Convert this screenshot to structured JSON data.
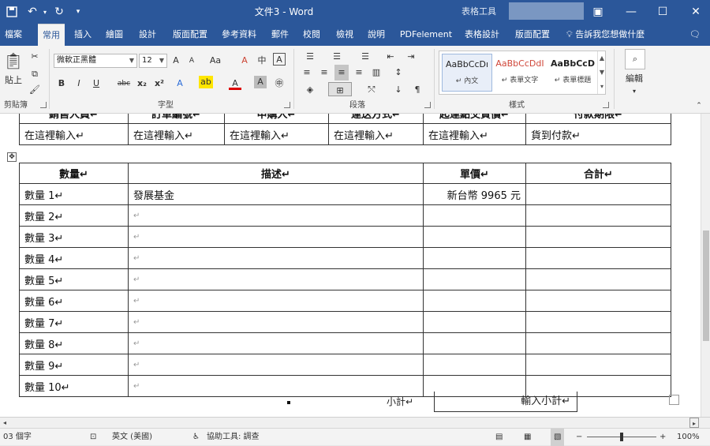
{
  "titlebar": {
    "title": "文件3 - Word",
    "context_tab_group": "表格工具",
    "quick_access": {
      "save_icon": "save-icon",
      "undo_icon": "undo-icon",
      "redo_icon": "redo-icon",
      "customize_icon": "customize-qat-icon"
    },
    "window_buttons": {
      "ribbon_display": "ribbon-display-icon",
      "minimize": "minimize-icon",
      "maximize": "maximize-icon",
      "close": "close-icon"
    }
  },
  "menu": {
    "tabs": [
      "檔案",
      "常用",
      "插入",
      "繪圖",
      "設計",
      "版面配置",
      "參考資料",
      "郵件",
      "校閱",
      "檢視",
      "說明",
      "PDFelement",
      "表格設計",
      "版面配置"
    ],
    "active_tab": "常用",
    "tell_me": "告訴我您想做什麼"
  },
  "ribbon": {
    "clipboard": {
      "paste": "貼上",
      "label": "剪貼簿"
    },
    "font": {
      "name": "微軟正黑體",
      "size": "12",
      "label": "字型",
      "bold": "B",
      "italic": "I",
      "underline": "U",
      "strike": "abc",
      "sub": "x₂",
      "sup": "x²",
      "grow": "A",
      "shrink": "A",
      "case": "Aa",
      "clear": "A",
      "phonetic": "中",
      "border_char": "A",
      "text_effect": "A",
      "highlight": "ab",
      "font_color": "A",
      "shade": "A",
      "enclose": "㊥"
    },
    "paragraph": {
      "label": "段落"
    },
    "styles": {
      "label": "樣式",
      "items": [
        {
          "sample": "AaBbCcDı",
          "name": "↵ 內文"
        },
        {
          "sample": "AaBbCcDdI",
          "name": "↵ 表單文字"
        },
        {
          "sample": "AaBbCcD",
          "name": "↵ 表單標題"
        }
      ]
    },
    "editing": {
      "label": "編輯"
    }
  },
  "document": {
    "top_table": {
      "headers": [
        "銷售人員↵",
        "訂單編號↵",
        "申購人↵",
        "運送方式↵",
        "起運點交貨價↵",
        "付款期限↵"
      ],
      "values": [
        "在這裡輸入↵",
        "在這裡輸入↵",
        "在這裡輸入↵",
        "在這裡輸入↵",
        "在這裡輸入↵",
        "貨到付款↵"
      ]
    },
    "items_table": {
      "headers": [
        "數量↵",
        "描述↵",
        "單價↵",
        "合計↵"
      ],
      "rows": [
        {
          "qty": "數量 1↵",
          "desc": "發展基金",
          "price": "新台幣 9965 元",
          "total": ""
        },
        {
          "qty": "數量 2↵",
          "desc": "↵",
          "price": "",
          "total": ""
        },
        {
          "qty": "數量 3↵",
          "desc": "↵",
          "price": "",
          "total": ""
        },
        {
          "qty": "數量 4↵",
          "desc": "↵",
          "price": "",
          "total": ""
        },
        {
          "qty": "數量 5↵",
          "desc": "↵",
          "price": "",
          "total": ""
        },
        {
          "qty": "數量 6↵",
          "desc": "↵",
          "price": "",
          "total": ""
        },
        {
          "qty": "數量 7↵",
          "desc": "↵",
          "price": "",
          "total": ""
        },
        {
          "qty": "數量 8↵",
          "desc": "↵",
          "price": "",
          "total": ""
        },
        {
          "qty": "數量 9↵",
          "desc": "↵",
          "price": "",
          "total": ""
        },
        {
          "qty": "數量 10↵",
          "desc": "↵",
          "price": "",
          "total": ""
        }
      ]
    },
    "subtotal": {
      "label": "小計↵",
      "value": "輸入小計↵"
    }
  },
  "statusbar": {
    "word_count": "03 個字",
    "language": "英文 (美國)",
    "accessibility": "協助工具: 調查",
    "zoom": "100%"
  }
}
